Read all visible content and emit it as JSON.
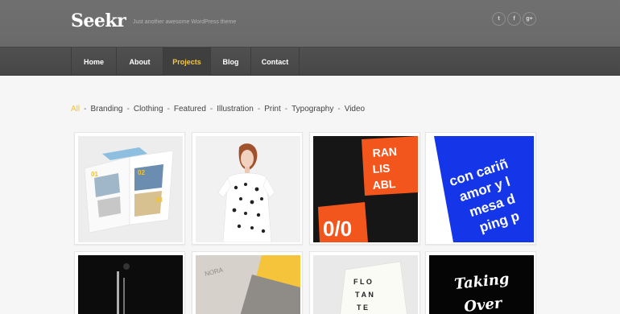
{
  "site": {
    "logo": "Seekr",
    "tagline": "Just another awesome WordPress theme"
  },
  "social": [
    {
      "icon": "twitter-icon",
      "glyph": "t"
    },
    {
      "icon": "facebook-icon",
      "glyph": "f"
    },
    {
      "icon": "google-plus-icon",
      "glyph": "g+"
    }
  ],
  "nav": {
    "items": [
      "Home",
      "About",
      "Projects",
      "Blog",
      "Contact"
    ],
    "active": "Projects"
  },
  "filters": {
    "items": [
      "All",
      "Branding",
      "Clothing",
      "Featured",
      "Illustration",
      "Print",
      "Typography",
      "Video"
    ],
    "active": "All",
    "separator": "-"
  },
  "colors": {
    "accent": "#f6c83c",
    "header": "#6c6c6c",
    "nav": "#4b4b4b",
    "orange": "#f2561d",
    "blue": "#1536e8"
  },
  "portfolio": {
    "row1": [
      {
        "name": "brochure-thumb",
        "labels": [
          "01",
          "02",
          "03"
        ]
      },
      {
        "name": "model-tshirt-thumb"
      },
      {
        "name": "orange-posters-thumb",
        "text": "RAN LIS ABL"
      },
      {
        "name": "blue-card-thumb",
        "lines": [
          "con cariñ",
          "amor y l",
          "mesa d",
          "ping p"
        ]
      }
    ],
    "row2": [
      {
        "name": "dark-photo-thumb"
      },
      {
        "name": "notebook-thumb",
        "text": "NORA"
      },
      {
        "name": "type-book-thumb",
        "text": "FLOTANTE"
      },
      {
        "name": "lettering-thumb",
        "lines": [
          "Taking",
          "Over"
        ]
      }
    ]
  }
}
